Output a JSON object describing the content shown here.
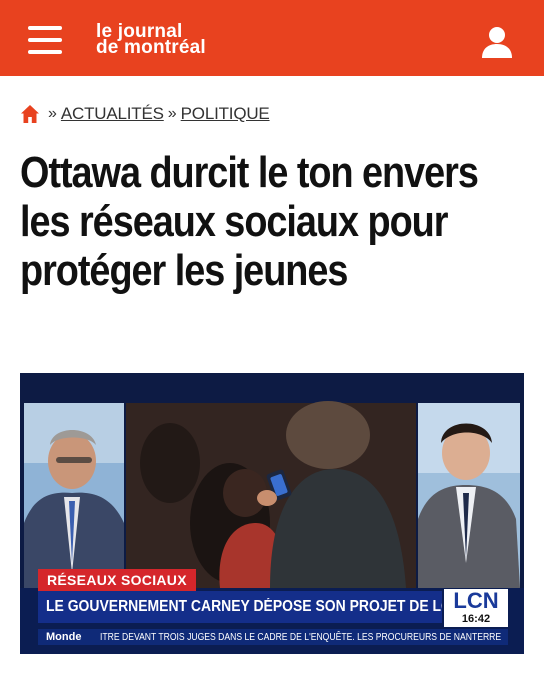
{
  "header": {
    "logo_line1": "le journal",
    "logo_line2": "de montréal",
    "menu_icon": "hamburger-menu-icon",
    "user_icon": "user-account-icon",
    "brand_color": "#e8421f"
  },
  "breadcrumb": {
    "home_icon": "home-icon",
    "separator": "»",
    "items": [
      {
        "label": "ACTUALITÉS"
      },
      {
        "label": "POLITIQUE"
      }
    ]
  },
  "article": {
    "title": "Ottawa durcit le ton envers les réseaux sociaux pour protéger les jeunes"
  },
  "video": {
    "tag": "RÉSEAUX SOCIAUX",
    "lower_third": "LE GOUVERNEMENT CARNEY DÉPOSE SON PROJET DE LOI",
    "channel": "LCN",
    "time": "16:42",
    "ticker_label": "Monde",
    "ticker_text": "ITRE DEVANT TROIS JUGES DANS LE CADRE DE L'ENQUÊTE. LES PROCUREURS DE NANTERRE",
    "colors": {
      "tag": "#d5262b",
      "strip": "#142e8a",
      "channel": "#1a3a9a"
    }
  }
}
